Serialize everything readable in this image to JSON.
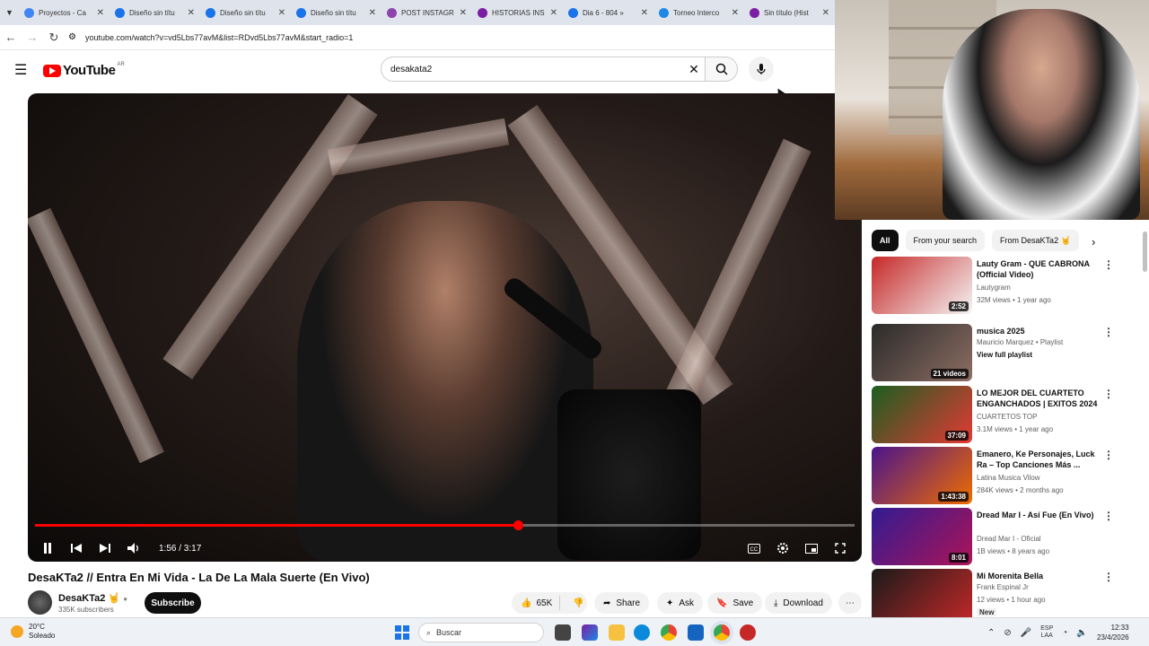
{
  "browser": {
    "tabs": [
      {
        "label": "Proyectos - Ca",
        "color": "#4285f4"
      },
      {
        "label": "Diseño sin títu",
        "color": "#1a73e8"
      },
      {
        "label": "Diseño sin títu",
        "color": "#1a73e8"
      },
      {
        "label": "Diseño sin títu",
        "color": "#1a73e8"
      },
      {
        "label": "POST INSTAGR",
        "color": "#8e44ad"
      },
      {
        "label": "HISTORIAS INS",
        "color": "#7b1fa2"
      },
      {
        "label": "Dia 6 - 804 »",
        "color": "#1a73e8"
      },
      {
        "label": "Torneo Interco",
        "color": "#1e88e5"
      },
      {
        "label": "Sin título (Hist",
        "color": "#7b1fa2"
      }
    ],
    "url": "youtube.com/watch?v=vd5Lbs77avM&list=RDvd5Lbs77avM&start_radio=1"
  },
  "youtube": {
    "logo": "YouTube",
    "country": "AR",
    "search_value": "desakata2"
  },
  "player": {
    "current_time": "1:56",
    "duration": "3:17",
    "time_display": "1:56 / 3:17",
    "progress": 0.5888
  },
  "video": {
    "title": "DesaKTa2 // Entra En Mi Vida - La De La Mala Suerte (En Vivo)",
    "channel": "DesaKTa2 🤘",
    "subscribers": "335K subscribers",
    "subscribe_label": "Subscribe",
    "likes": "65K",
    "share_label": "Share",
    "ask_label": "Ask",
    "save_label": "Save",
    "download_label": "Download"
  },
  "filters": [
    "All",
    "From your search",
    "From DesaKTa2 🤘"
  ],
  "recommendations": [
    {
      "title": "Lauty Gram - QUE CABRONA (Official Video)",
      "channel": "Lautygram",
      "meta": "32M views • 1 year ago",
      "duration": "2:52",
      "colors": [
        "#c62828",
        "#f5f5f5"
      ]
    },
    {
      "title": "musica 2025",
      "channel": "Mauricio Marquez • Playlist",
      "meta": "View full playlist",
      "duration": "21 videos",
      "colors": [
        "#2a2a2a",
        "#8d6e63"
      ]
    },
    {
      "title": "LO MEJOR DEL CUARTETO ENGANCHADOS | EXITOS 2024",
      "channel": "CUARTETOS TOP",
      "meta": "3.1M views • 1 year ago",
      "duration": "37:09",
      "colors": [
        "#1b5e20",
        "#e53935"
      ]
    },
    {
      "title": "Emanero, Ke Personajes, Luck Ra – Top Canciones Más ...",
      "channel": "Latina Musica Vilow",
      "meta": "284K views • 2 months ago",
      "duration": "1:43:38",
      "colors": [
        "#4a148c",
        "#ef6c00"
      ]
    },
    {
      "title": "Dread Mar I - Así Fue (En Vivo)",
      "channel": "Dread Mar I - Oficial",
      "meta": "1B views • 8 years ago",
      "duration": "8:01",
      "colors": [
        "#311b92",
        "#ad1457"
      ]
    },
    {
      "title": "Mi Morenita Bella",
      "channel": "Frank Espinal Jr",
      "meta": "12 views • 1 hour ago",
      "badge": "New",
      "duration": "",
      "colors": [
        "#1a1a1a",
        "#c62828"
      ]
    }
  ],
  "taskbar": {
    "temp": "20°C",
    "weather": "Soleado",
    "search_placeholder": "Buscar",
    "lang_top": "ESP",
    "lang_bottom": "LAA",
    "time": "12:33",
    "date": "23/4/2026"
  }
}
